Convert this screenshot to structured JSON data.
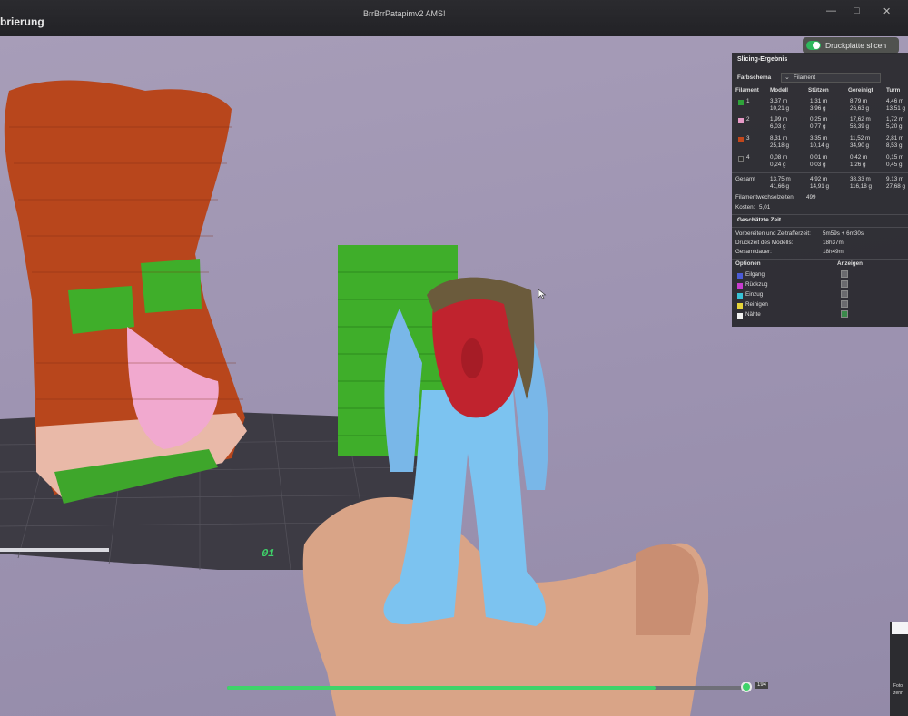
{
  "titlebar": {
    "left_label": "brierung",
    "window_title": "BrrBrrPatapimv2 AMS!",
    "controls": [
      "—",
      "□",
      "✕"
    ]
  },
  "slice_button": {
    "label": "Druckplatte slicen"
  },
  "panel": {
    "title": "Slicing-Ergebnis",
    "scheme_label": "Farbschema",
    "scheme_value": "Filament",
    "columns": [
      "Filament",
      "Modell",
      "Stützen",
      "Gereinigt",
      "Turm"
    ],
    "rows": [
      {
        "id": "1",
        "color": "#2fa33a",
        "modell": [
          "3,37 m",
          "10,21 g"
        ],
        "stuetzen": [
          "1,31 m",
          "3,96 g"
        ],
        "gereinigt": [
          "8,79 m",
          "26,63 g"
        ],
        "turm": [
          "4,46 m",
          "13,51 g"
        ]
      },
      {
        "id": "2",
        "color": "#e79ac7",
        "modell": [
          "1,99 m",
          "6,03 g"
        ],
        "stuetzen": [
          "0,25 m",
          "0,77 g"
        ],
        "gereinigt": [
          "17,62 m",
          "53,39 g"
        ],
        "turm": [
          "1,72 m",
          "5,20 g"
        ]
      },
      {
        "id": "3",
        "color": "#c2471b",
        "modell": [
          "8,31 m",
          "25,18 g"
        ],
        "stuetzen": [
          "3,35 m",
          "10,14 g"
        ],
        "gereinigt": [
          "11,52 m",
          "34,90 g"
        ],
        "turm": [
          "2,81 m",
          "8,53 g"
        ]
      },
      {
        "id": "4",
        "color": "#2d2d2d",
        "modell": [
          "0,08 m",
          "0,24 g"
        ],
        "stuetzen": [
          "0,01 m",
          "0,03 g"
        ],
        "gereinigt": [
          "0,42 m",
          "1,26 g"
        ],
        "turm": [
          "0,15 m",
          "0,45 g"
        ]
      }
    ],
    "total": {
      "label": "Gesamt",
      "modell": [
        "13,75 m",
        "41,66 g"
      ],
      "stuetzen": [
        "4,92 m",
        "14,91 g"
      ],
      "gereinigt": [
        "38,33 m",
        "116,18 g"
      ],
      "turm": [
        "9,13 m",
        "27,68 g"
      ]
    },
    "filament_changes": {
      "label": "Filamentwechselzeiten:",
      "value": "499"
    },
    "costs": {
      "label": "Kosten:",
      "value": "5,01"
    },
    "time_header": "Geschätzte Zeit",
    "times": [
      {
        "label": "Vorbereiten und Zeitrafferzeit:",
        "value": "5m59s + 6m30s"
      },
      {
        "label": "Druckzeit des Modells:",
        "value": "18h37m"
      },
      {
        "label": "Gesamtdauer:",
        "value": "18h49m"
      }
    ],
    "options_header": "Optionen",
    "show_header": "Anzeigen",
    "options": [
      {
        "label": "Eilgang",
        "color": "#4b5bd6",
        "checked": false
      },
      {
        "label": "Rückzug",
        "color": "#c83ccf",
        "checked": false
      },
      {
        "label": "Einzug",
        "color": "#38c2d6",
        "checked": false
      },
      {
        "label": "Reinigen",
        "color": "#e6d43a",
        "checked": false
      },
      {
        "label": "Nähte",
        "color": "#f2f2f2",
        "checked": true
      }
    ]
  },
  "plate_number": "01",
  "layer_slider": {
    "value_label": "194",
    "fraction": 0.82
  },
  "corner_label": [
    "Foto",
    "zehn"
  ]
}
